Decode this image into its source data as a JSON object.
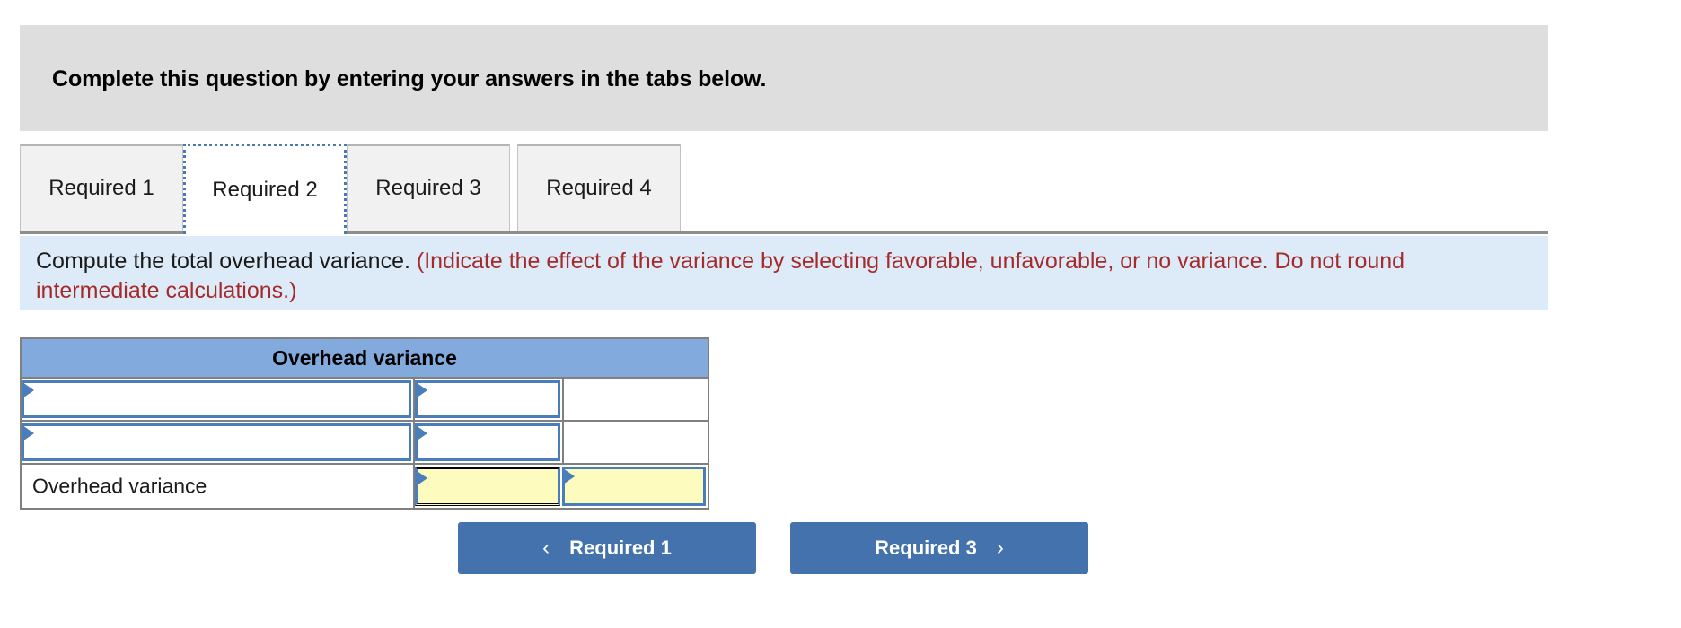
{
  "banner": {
    "text": "Complete this question by entering your answers in the tabs below."
  },
  "tabs": [
    {
      "label": "Required 1",
      "active": false
    },
    {
      "label": "Required 2",
      "active": true
    },
    {
      "label": "Required 3",
      "active": false
    },
    {
      "label": "Required 4",
      "active": false
    }
  ],
  "prompt": {
    "black_text": "Compute the total overhead variance.",
    "red_text": "(Indicate the effect of the variance by selecting favorable, unfavorable, or no variance. Do not round intermediate calculations.)"
  },
  "table": {
    "header": "Overhead variance",
    "rows": [
      {
        "label": "",
        "amount": "",
        "effect": "",
        "label_input": true,
        "amount_input": true,
        "effect_input": false,
        "highlight": false,
        "total": false
      },
      {
        "label": "",
        "amount": "",
        "effect": "",
        "label_input": true,
        "amount_input": true,
        "effect_input": false,
        "highlight": false,
        "total": false
      },
      {
        "label": "Overhead variance",
        "amount": "",
        "effect": "",
        "label_input": false,
        "amount_input": true,
        "effect_input": true,
        "highlight": true,
        "total": true
      }
    ]
  },
  "nav": {
    "prev_label": "Required 1",
    "next_label": "Required 3",
    "prev_icon": "chevron-left-icon",
    "next_icon": "chevron-right-icon",
    "prev_chevron": "‹",
    "next_chevron": "›"
  },
  "colors": {
    "banner_bg": "#dedede",
    "prompt_bg": "#ddebf8",
    "prompt_red": "#a52a2a",
    "table_header_bg": "#83aadd",
    "entry_border": "#4a7ebb",
    "highlight_bg": "#fdfbbe",
    "button_bg": "#4372ad",
    "tab_active_border": "#4a78b4"
  }
}
